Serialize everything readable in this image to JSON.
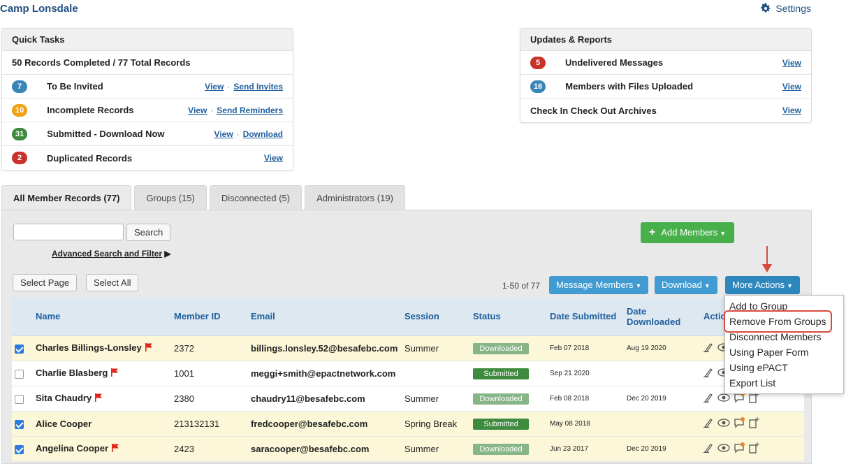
{
  "header": {
    "org_name": "Camp Lonsdale",
    "settings_label": "Settings"
  },
  "quick_tasks": {
    "title": "Quick Tasks",
    "summary": "50 Records Completed / 77 Total Records",
    "rows": [
      {
        "count": "7",
        "color": "#3a85b8",
        "label": "To Be Invited",
        "link1": "View",
        "link2": "Send Invites"
      },
      {
        "count": "10",
        "color": "#f0a11a",
        "label": "Incomplete Records",
        "link1": "View",
        "link2": "Send Reminders"
      },
      {
        "count": "31",
        "color": "#3e8a3e",
        "label": "Submitted - Download Now",
        "link1": "View",
        "link2": "Download"
      },
      {
        "count": "2",
        "color": "#c9322a",
        "label": "Duplicated Records",
        "link1": "View"
      }
    ]
  },
  "updates": {
    "title": "Updates & Reports",
    "rows": [
      {
        "count": "5",
        "color": "#c9322a",
        "label": "Undelivered Messages",
        "link": "View"
      },
      {
        "count": "16",
        "color": "#3a85b8",
        "label": "Members with Files Uploaded",
        "link": "View"
      },
      {
        "label": "Check In Check Out Archives",
        "link": "View"
      }
    ]
  },
  "tabs": [
    "All Member Records (77)",
    "Groups (15)",
    "Disconnected (5)",
    "Administrators (19)"
  ],
  "toolbar": {
    "search_label": "Search",
    "advanced_label": "Advanced Search and Filter",
    "add_members_label": "Add Members",
    "select_page_label": "Select Page",
    "select_all_label": "Select All",
    "count_text": "1-50 of 77",
    "message_members_label": "Message Members",
    "download_label": "Download",
    "more_actions_label": "More Actions"
  },
  "table": {
    "headers": {
      "name": "Name",
      "member_id": "Member ID",
      "email": "Email",
      "session": "Session",
      "status": "Status",
      "date_submitted": "Date Submitted",
      "date_downloaded": "Date Downloaded",
      "actions": "Actio"
    },
    "rows": [
      {
        "checked": true,
        "name": "Charles Billings-Lonsley",
        "flag": true,
        "member_id": "2372",
        "email": "billings.lonsley.52@besafebc.com",
        "session": "Summer",
        "status": "Downloaded",
        "date_submitted": "Feb 07 2018",
        "date_downloaded": "Aug 19 2020"
      },
      {
        "checked": false,
        "name": "Charlie Blasberg",
        "flag": true,
        "member_id": "1001",
        "email": "meggi+smith@epactnetwork.com",
        "session": "",
        "status": "Submitted",
        "date_submitted": "Sep 21 2020",
        "date_downloaded": ""
      },
      {
        "checked": false,
        "name": "Sita Chaudry",
        "flag": true,
        "member_id": "2380",
        "email": "chaudry11@besafebc.com",
        "session": "Summer",
        "status": "Downloaded",
        "date_submitted": "Feb 08 2018",
        "date_downloaded": "Dec 20 2019"
      },
      {
        "checked": true,
        "name": "Alice Cooper",
        "flag": false,
        "member_id": "213132131",
        "email": "fredcooper@besafebc.com",
        "session": "Spring Break",
        "status": "Submitted",
        "date_submitted": "May 08 2018",
        "date_downloaded": ""
      },
      {
        "checked": true,
        "name": "Angelina Cooper",
        "flag": true,
        "member_id": "2423",
        "email": "saracooper@besafebc.com",
        "session": "Summer",
        "status": "Downloaded",
        "date_submitted": "Jun 23 2017",
        "date_downloaded": "Dec 20 2019"
      }
    ]
  },
  "more_actions_menu": [
    "Add to Group",
    "Remove From Groups",
    "Disconnect Members",
    "Using Paper Form",
    "Using ePACT",
    "Export List"
  ],
  "colors": {
    "downloaded": "#87b587",
    "submitted": "#3e8a3e",
    "highlight": "#d94a3c",
    "flag": "#e0241c"
  }
}
